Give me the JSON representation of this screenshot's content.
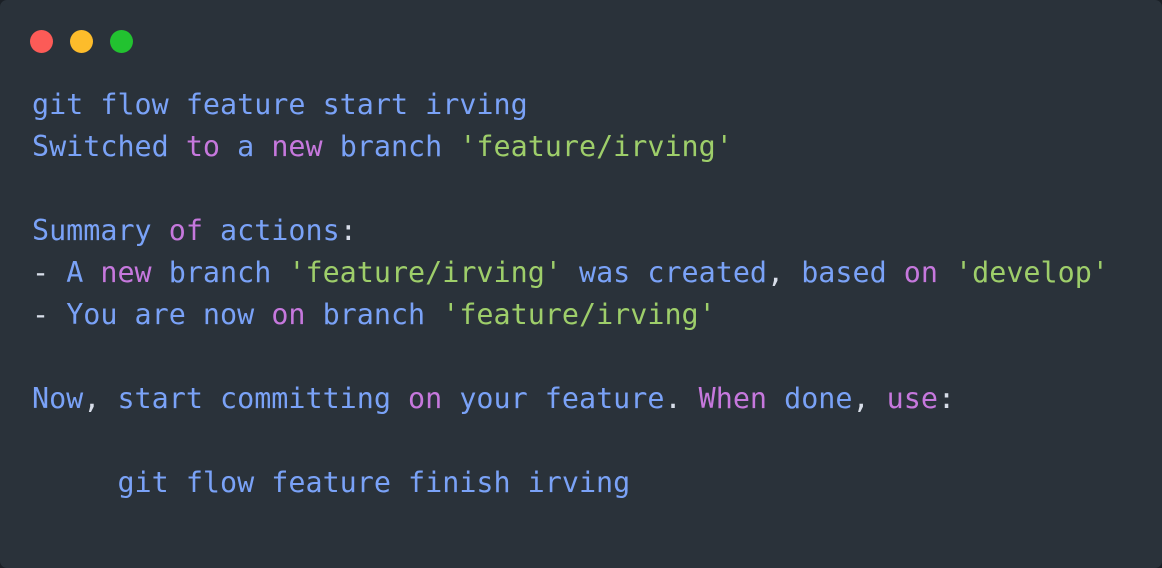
{
  "window": {
    "kind": "terminal-window",
    "background_color": "#2a323a",
    "titlebar": {
      "buttons": [
        {
          "name": "close-button",
          "label": "Close",
          "color": "#fc5b57"
        },
        {
          "name": "minimize-button",
          "label": "Minimize",
          "color": "#fdbc2b"
        },
        {
          "name": "maximize-button",
          "label": "Maximize",
          "color": "#22c230"
        }
      ]
    }
  },
  "palette": {
    "blue": "#7aa2f7",
    "magenta": "#c678dd",
    "green": "#9ece6a",
    "plain": "#d8dee9",
    "background": "#2a323a"
  },
  "terminal": {
    "command": "git flow feature start irving",
    "plain_text": "git flow feature start irving\nSwitched to a new branch 'feature/irving'\n\nSummary of actions:\n- A new branch 'feature/irving' was created, based on 'develop'\n- You are now on branch 'feature/irving'\n\nNow, start committing on your feature. When done, use:\n\n     git flow feature finish irving",
    "lines": [
      {
        "id": "line-command",
        "tokens": [
          {
            "t": "git flow feature start irving",
            "c": "blue"
          }
        ]
      },
      {
        "id": "line-switched",
        "tokens": [
          {
            "t": "Switched ",
            "c": "blue"
          },
          {
            "t": "to ",
            "c": "magenta"
          },
          {
            "t": "a ",
            "c": "blue"
          },
          {
            "t": "new ",
            "c": "magenta"
          },
          {
            "t": "branch ",
            "c": "blue"
          },
          {
            "t": "'feature/irving'",
            "c": "green"
          }
        ]
      },
      {
        "id": "line-blank-1",
        "tokens": []
      },
      {
        "id": "line-summary-header",
        "tokens": [
          {
            "t": "Summary ",
            "c": "blue"
          },
          {
            "t": "of ",
            "c": "magenta"
          },
          {
            "t": "actions",
            "c": "blue"
          },
          {
            "t": ":",
            "c": "plain"
          }
        ]
      },
      {
        "id": "line-bullet-created",
        "tokens": [
          {
            "t": "- ",
            "c": "plain"
          },
          {
            "t": "A ",
            "c": "blue"
          },
          {
            "t": "new ",
            "c": "magenta"
          },
          {
            "t": "branch ",
            "c": "blue"
          },
          {
            "t": "'feature/irving' ",
            "c": "green"
          },
          {
            "t": "was created",
            "c": "blue"
          },
          {
            "t": ", ",
            "c": "plain"
          },
          {
            "t": "based ",
            "c": "blue"
          },
          {
            "t": "on ",
            "c": "magenta"
          },
          {
            "t": "'develop'",
            "c": "green"
          }
        ]
      },
      {
        "id": "line-bullet-current",
        "tokens": [
          {
            "t": "- ",
            "c": "plain"
          },
          {
            "t": "You are now ",
            "c": "blue"
          },
          {
            "t": "on ",
            "c": "magenta"
          },
          {
            "t": "branch ",
            "c": "blue"
          },
          {
            "t": "'feature/irving'",
            "c": "green"
          }
        ]
      },
      {
        "id": "line-blank-2",
        "tokens": []
      },
      {
        "id": "line-next-steps",
        "tokens": [
          {
            "t": "Now",
            "c": "blue"
          },
          {
            "t": ", ",
            "c": "plain"
          },
          {
            "t": "start committing ",
            "c": "blue"
          },
          {
            "t": "on ",
            "c": "magenta"
          },
          {
            "t": "your feature",
            "c": "blue"
          },
          {
            "t": ". ",
            "c": "plain"
          },
          {
            "t": "When ",
            "c": "magenta"
          },
          {
            "t": "done",
            "c": "blue"
          },
          {
            "t": ", ",
            "c": "plain"
          },
          {
            "t": "use",
            "c": "magenta"
          },
          {
            "t": ":",
            "c": "plain"
          }
        ]
      },
      {
        "id": "line-blank-3",
        "tokens": []
      },
      {
        "id": "line-finish-hint",
        "tokens": [
          {
            "t": "     git flow feature finish irving",
            "c": "blue"
          }
        ]
      }
    ]
  }
}
